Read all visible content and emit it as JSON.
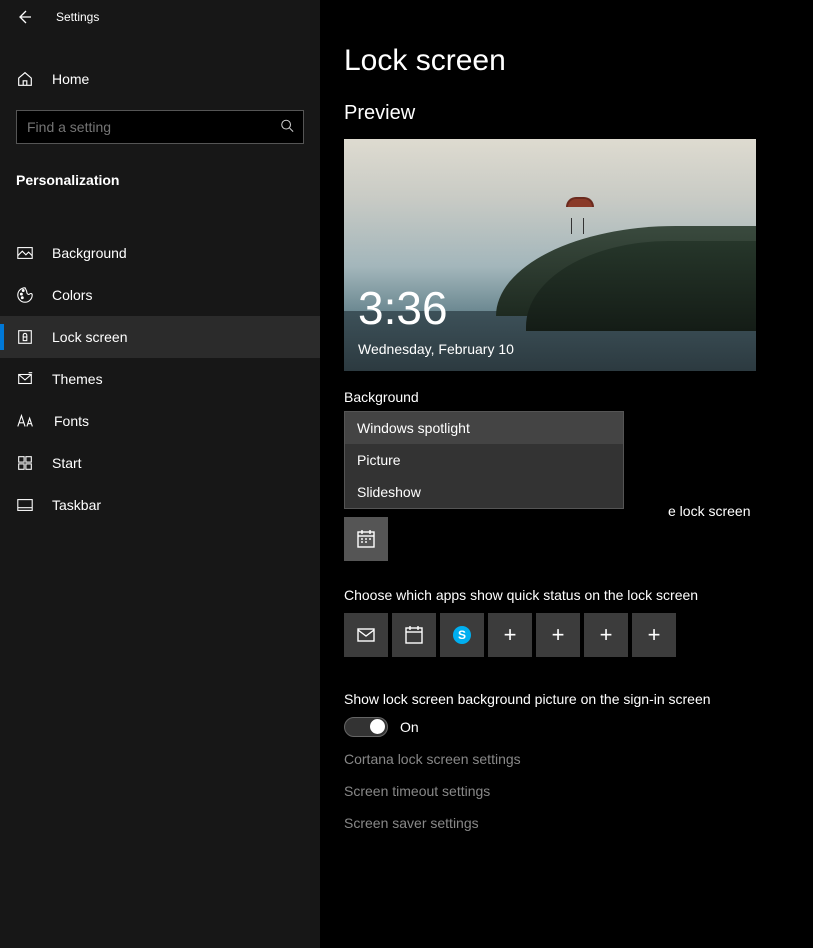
{
  "header": {
    "title": "Settings"
  },
  "sidebar": {
    "home": "Home",
    "search_placeholder": "Find a setting",
    "section": "Personalization",
    "items": [
      {
        "label": "Background"
      },
      {
        "label": "Colors"
      },
      {
        "label": "Lock screen"
      },
      {
        "label": "Themes"
      },
      {
        "label": "Fonts"
      },
      {
        "label": "Start"
      },
      {
        "label": "Taskbar"
      }
    ]
  },
  "main": {
    "title": "Lock screen",
    "preview_heading": "Preview",
    "preview_time": "3:36",
    "preview_date": "Wednesday, February 10",
    "bg_label": "Background",
    "bg_options": [
      "Windows spotlight",
      "Picture",
      "Slideshow"
    ],
    "detailed_label_tail": "e lock screen",
    "detailed_app_icon": "calendar-icon",
    "quick_label": "Choose which apps show quick status on the lock screen",
    "quick_apps": [
      "mail-icon",
      "calendar-icon",
      "skype-icon",
      "add",
      "add",
      "add",
      "add"
    ],
    "signin_label": "Show lock screen background picture on the sign-in screen",
    "signin_state": "On",
    "links": [
      "Cortana lock screen settings",
      "Screen timeout settings",
      "Screen saver settings"
    ]
  }
}
